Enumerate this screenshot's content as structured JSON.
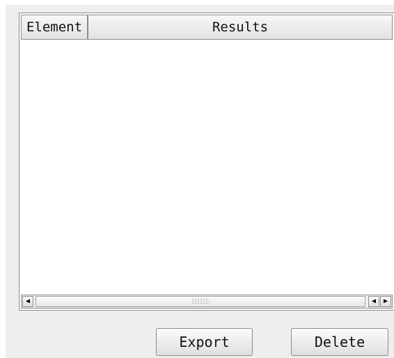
{
  "table": {
    "columns": [
      {
        "label": "Element"
      },
      {
        "label": "Results"
      }
    ],
    "rows": []
  },
  "scrollbar": {
    "left_icon": "arrow-left-icon",
    "right_icons": [
      "arrow-left-icon",
      "arrow-right-icon"
    ],
    "grip_icon": "grip-icon"
  },
  "actions": {
    "export_label": "Export",
    "delete_label": "Delete"
  },
  "colors": {
    "panel": "#eeeeee",
    "table_bg": "#ffffff",
    "border": "#8c8c8c"
  }
}
